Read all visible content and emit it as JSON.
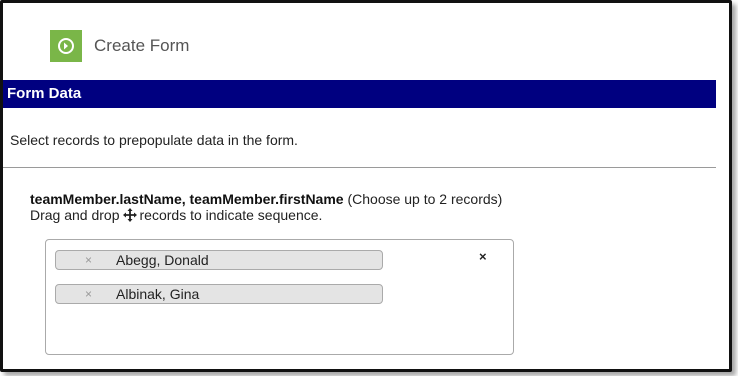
{
  "toolbar": {
    "create_form_label": "Create Form",
    "create_form_icon": "arrow-circle-icon",
    "accent_color": "#7ab648"
  },
  "section": {
    "title": "Form Data",
    "header_color": "#000080"
  },
  "instruction": "Select records to prepopulate data in the form.",
  "field": {
    "label_bold": "teamMember.lastName, teamMember.firstName",
    "label_hint": "(Choose up to 2 records)",
    "drag_text_before": "Drag and drop",
    "drag_text_after": "records to indicate sequence.",
    "drag_icon": "move-icon"
  },
  "selected_records": [
    {
      "remove_glyph": "×",
      "label": "Abegg, Donald"
    },
    {
      "remove_glyph": "×",
      "label": "Albinak, Gina"
    }
  ],
  "clear_all_glyph": "×"
}
